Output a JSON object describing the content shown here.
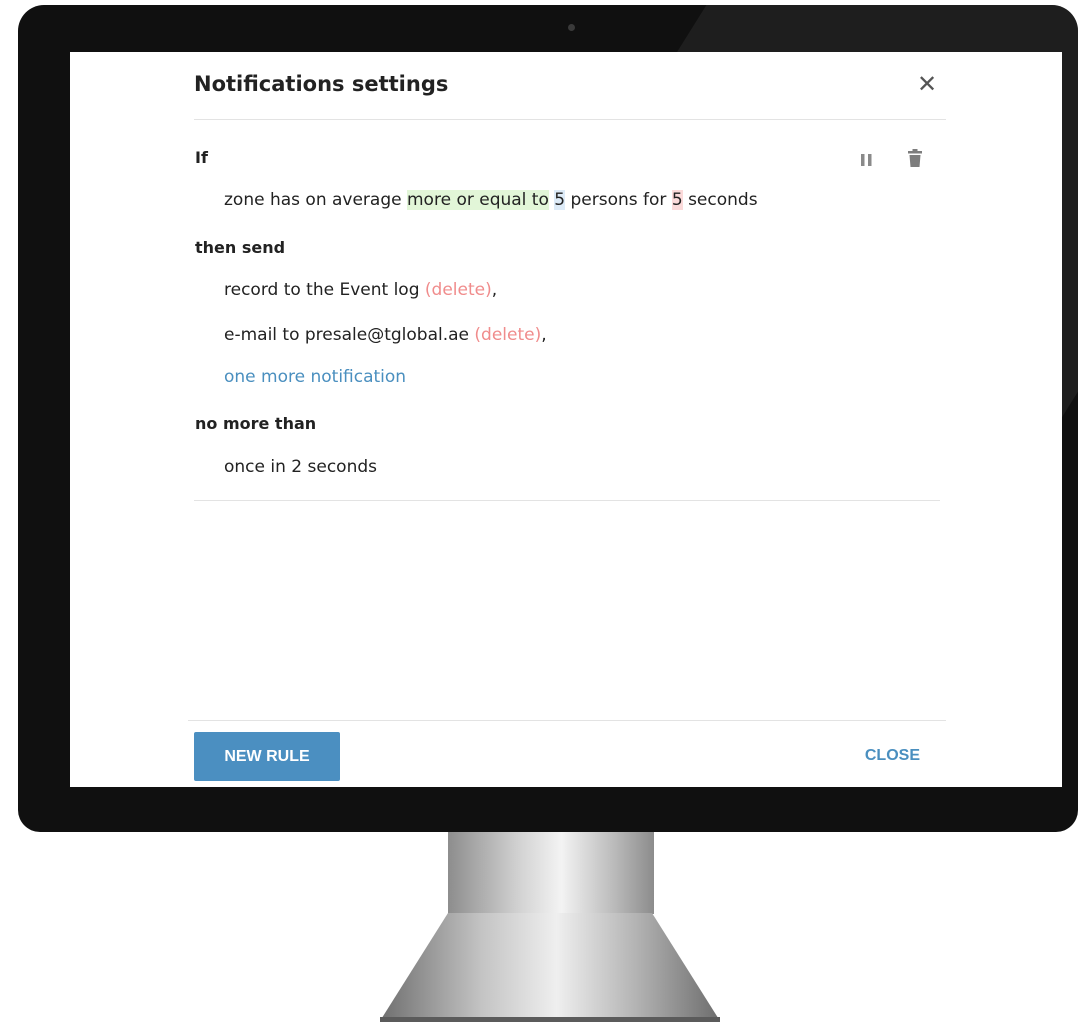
{
  "dialog": {
    "title": "Notifications settings",
    "close_icon": "close-icon"
  },
  "rule": {
    "if_label": "If",
    "condition": {
      "prefix": "zone has on average",
      "operator": "more or equal to",
      "count": "5",
      "middle": "persons for",
      "duration": "5",
      "suffix": "seconds"
    },
    "then_label": "then send",
    "notifications": [
      {
        "text": "record to the Event log",
        "delete_label": "(delete)",
        "separator": ","
      },
      {
        "text": "e-mail to presale@tglobal.ae",
        "delete_label": "(delete)",
        "separator": ","
      }
    ],
    "add_notification_label": "one more notification",
    "limit_label": "no more than",
    "limit_text": "once in 2 seconds",
    "icons": {
      "pause": "pause-icon",
      "delete": "trash-icon"
    }
  },
  "footer": {
    "new_rule_label": "NEW RULE",
    "close_label": "CLOSE"
  },
  "colors": {
    "accent": "#4b8fc1",
    "link": "#4a8fbf",
    "delete_link": "#f08c8c",
    "highlight_operator": "#e2f6d8",
    "highlight_count": "#ddebf8",
    "highlight_duration": "#fbdada"
  }
}
